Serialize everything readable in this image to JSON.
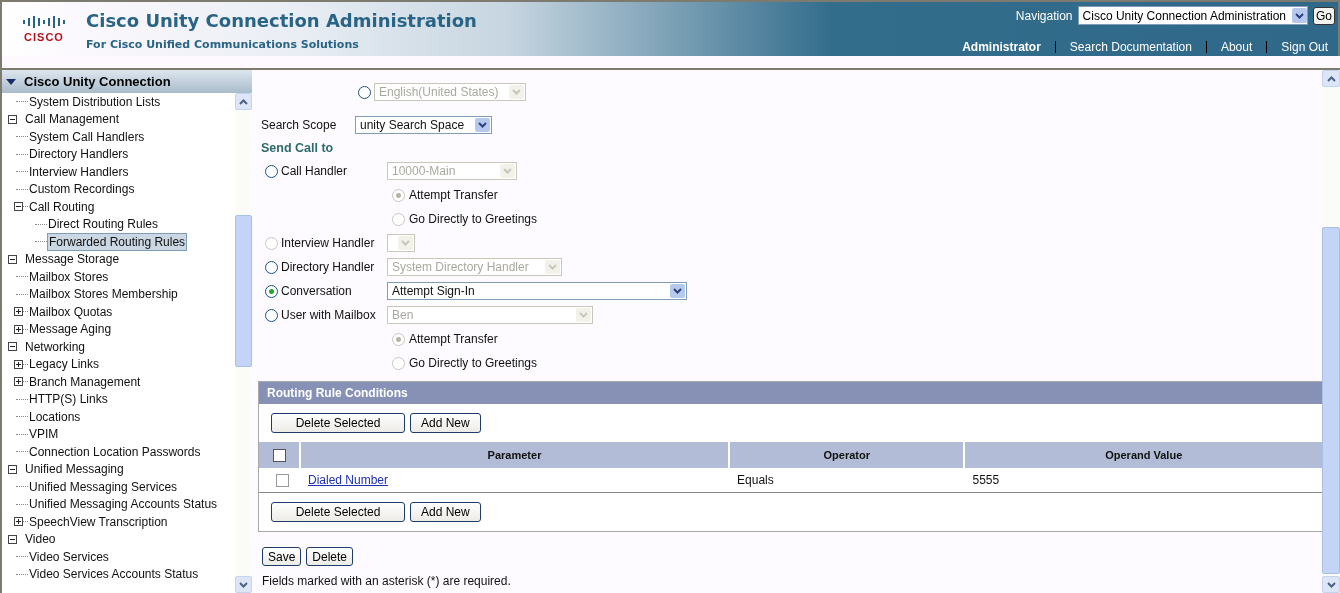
{
  "header": {
    "logo": "CISCO",
    "title": "Cisco Unity Connection Administration",
    "subtitle": "For Cisco Unified Communications Solutions",
    "navigation": {
      "label": "Navigation",
      "value": "Cisco Unity Connection Administration",
      "go": "Go"
    },
    "links": [
      {
        "label": "Administrator",
        "selected": true
      },
      {
        "label": "Search Documentation",
        "selected": false
      },
      {
        "label": "About",
        "selected": false
      },
      {
        "label": "Sign Out",
        "selected": false
      }
    ]
  },
  "sidebar": {
    "title": "Cisco Unity Connection",
    "tree": [
      {
        "label": "System Distribution Lists",
        "kind": "continued",
        "selected": false
      },
      {
        "label": "Call Management",
        "kind": "node",
        "selected": false,
        "expanded": true,
        "children": [
          {
            "label": "System Call Handlers",
            "selected": false
          },
          {
            "label": "Directory Handlers",
            "selected": false
          },
          {
            "label": "Interview Handlers",
            "selected": false
          },
          {
            "label": "Custom Recordings",
            "selected": false
          },
          {
            "label": "Call Routing",
            "selected": false,
            "expanded": true,
            "children": [
              {
                "label": "Direct Routing Rules",
                "selected": false
              },
              {
                "label": "Forwarded Routing Rules",
                "selected": true
              }
            ]
          }
        ]
      },
      {
        "label": "Message Storage",
        "kind": "node",
        "selected": false,
        "expanded": true,
        "children": [
          {
            "label": "Mailbox Stores",
            "selected": false
          },
          {
            "label": "Mailbox Stores Membership",
            "selected": false
          },
          {
            "label": "Mailbox Quotas",
            "selected": false,
            "expanded": false
          },
          {
            "label": "Message Aging",
            "selected": false,
            "expanded": false
          }
        ]
      },
      {
        "label": "Networking",
        "kind": "node",
        "selected": false,
        "expanded": true,
        "children": [
          {
            "label": "Legacy Links",
            "selected": false,
            "expanded": false
          },
          {
            "label": "Branch Management",
            "selected": false,
            "expanded": false
          },
          {
            "label": "HTTP(S) Links",
            "selected": false
          },
          {
            "label": "Locations",
            "selected": false
          },
          {
            "label": "VPIM",
            "selected": false
          },
          {
            "label": "Connection Location Passwords",
            "selected": false
          }
        ]
      },
      {
        "label": "Unified Messaging",
        "kind": "node",
        "selected": false,
        "expanded": true,
        "children": [
          {
            "label": "Unified Messaging Services",
            "selected": false
          },
          {
            "label": "Unified Messaging Accounts Status",
            "selected": false
          },
          {
            "label": "SpeechView Transcription",
            "selected": false,
            "expanded": false
          }
        ]
      },
      {
        "label": "Video",
        "kind": "node",
        "selected": false,
        "expanded": true,
        "children": [
          {
            "label": "Video Services",
            "selected": false
          },
          {
            "label": "Video Services Accounts Status",
            "selected": false
          }
        ]
      }
    ]
  },
  "form": {
    "language": {
      "selected": false,
      "disabled": false,
      "select": {
        "value": "English(United States)",
        "disabled": true
      }
    },
    "search_scope": {
      "label": "Search Scope",
      "value": "unity Search Space"
    },
    "send_call_to": {
      "heading": "Send Call to",
      "options": [
        {
          "label": "Call Handler",
          "selected": false,
          "disabled": false,
          "select": {
            "value": "10000-Main",
            "disabled": true
          },
          "sub_options": [
            {
              "label": "Attempt Transfer",
              "selected": true,
              "disabled": true
            },
            {
              "label": "Go Directly to Greetings",
              "selected": false,
              "disabled": true
            }
          ]
        },
        {
          "label": "Interview Handler",
          "selected": false,
          "disabled": true,
          "select": {
            "disabled": true
          }
        },
        {
          "label": "Directory Handler",
          "selected": false,
          "disabled": false,
          "select": {
            "value": "System Directory Handler",
            "disabled": true
          }
        },
        {
          "label": "Conversation",
          "selected": true,
          "disabled": false,
          "select": {
            "value": "Attempt Sign-In",
            "disabled": false
          }
        },
        {
          "label": "User with Mailbox",
          "selected": false,
          "disabled": false,
          "select": {
            "value": "Ben",
            "disabled": true
          },
          "sub_options": [
            {
              "label": "Attempt Transfer",
              "selected": true,
              "disabled": true
            },
            {
              "label": "Go Directly to Greetings",
              "selected": false,
              "disabled": true
            }
          ]
        }
      ]
    }
  },
  "conditions": {
    "title": "Routing Rule Conditions",
    "buttons_top": [
      "Delete Selected",
      "Add New"
    ],
    "columns": [
      {
        "kind": "checkbox",
        "checked": false
      },
      {
        "kind": "text",
        "label": "Parameter"
      },
      {
        "kind": "text",
        "label": "Operator"
      },
      {
        "kind": "text",
        "label": "Operand Value"
      }
    ],
    "rows": [
      {
        "checked": false,
        "parameter": "Dialed Number",
        "operator": "Equals",
        "operand": "5555"
      }
    ],
    "buttons_bottom": [
      "Delete Selected",
      "Add New"
    ]
  },
  "actions": [
    "Save",
    "Delete"
  ],
  "note": "Fields marked with an asterisk (*) are required."
}
